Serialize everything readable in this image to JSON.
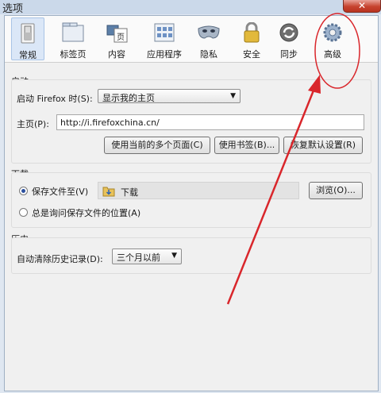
{
  "window": {
    "title": "选项",
    "close_glyph": "✕"
  },
  "tabs": [
    {
      "label": "常规",
      "icon": "switch-icon"
    },
    {
      "label": "标签页",
      "icon": "tabs-icon"
    },
    {
      "label": "内容",
      "icon": "content-icon"
    },
    {
      "label": "应用程序",
      "icon": "applications-icon"
    },
    {
      "label": "隐私",
      "icon": "mask-icon"
    },
    {
      "label": "安全",
      "icon": "padlock-icon"
    },
    {
      "label": "同步",
      "icon": "sync-icon"
    },
    {
      "label": "高级",
      "icon": "gear-icon"
    }
  ],
  "startup": {
    "group_title": "启动",
    "when_label": "启动 Firefox 时(S):",
    "when_value": "显示我的主页",
    "home_label": "主页(P):",
    "home_value": "http://i.firefoxchina.cn/",
    "use_current_pages": "使用当前的多个页面(C)",
    "use_bookmark": "使用书签(B)...",
    "restore_default": "恢复默认设置(R)"
  },
  "downloads": {
    "group_title": "下载",
    "save_to_label": "保存文件至(V)",
    "folder_name": "下载",
    "browse": "浏览(O)...",
    "always_ask_label": "总是询问保存文件的位置(A)"
  },
  "history": {
    "group_title": "历史",
    "auto_clear_label": "自动清除历史记录(D):",
    "auto_clear_value": "三个月以前"
  },
  "colors": {
    "annotation_red": "#d9262b",
    "selected_tab": "#dbe7f7"
  }
}
